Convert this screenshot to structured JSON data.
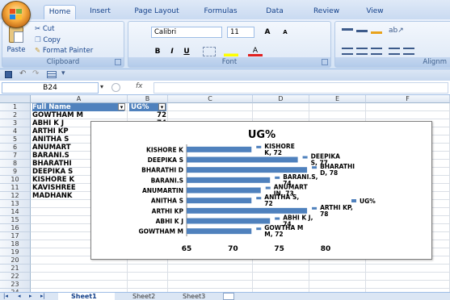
{
  "ribbon_tabs": [
    "Home",
    "Insert",
    "Page Layout",
    "Formulas",
    "Data",
    "Review",
    "View"
  ],
  "clipboard": {
    "paste_label": "Paste",
    "cut_label": "Cut",
    "copy_label": "Copy",
    "format_painter_label": "Format Painter",
    "group_label": "Clipboard"
  },
  "font": {
    "name": "Calibri",
    "size": "11",
    "group_label": "Font",
    "bold": "B",
    "italic": "I",
    "underline": "U",
    "grow": "A",
    "shrink": "A"
  },
  "alignment": {
    "group_label": "Alignm"
  },
  "name_box": "B24",
  "fx_label": "fx",
  "columns": [
    "A",
    "B",
    "C",
    "D",
    "E",
    "F"
  ],
  "rows": [
    {
      "num": "1",
      "a": "Full Name",
      "b": "UG%",
      "header": true
    },
    {
      "num": "2",
      "a": "GOWTHAM M",
      "b": "72"
    },
    {
      "num": "3",
      "a": "ABHI K J",
      "b": "74"
    },
    {
      "num": "4",
      "a": "ARTHI KP",
      "b": ""
    },
    {
      "num": "5",
      "a": "ANITHA S",
      "b": ""
    },
    {
      "num": "6",
      "a": "ANUMART",
      "b": ""
    },
    {
      "num": "7",
      "a": "BARANI.S",
      "b": ""
    },
    {
      "num": "8",
      "a": "BHARATHI",
      "b": ""
    },
    {
      "num": "9",
      "a": "DEEPIKA S",
      "b": ""
    },
    {
      "num": "10",
      "a": "KISHORE K",
      "b": ""
    },
    {
      "num": "11",
      "a": "KAVISHREE",
      "b": ""
    },
    {
      "num": "12",
      "a": "MADHANK",
      "b": ""
    },
    {
      "num": "13",
      "a": "",
      "b": ""
    },
    {
      "num": "14",
      "a": "",
      "b": ""
    },
    {
      "num": "15",
      "a": "",
      "b": ""
    },
    {
      "num": "16",
      "a": "",
      "b": ""
    },
    {
      "num": "17",
      "a": "",
      "b": ""
    },
    {
      "num": "18",
      "a": "",
      "b": ""
    },
    {
      "num": "19",
      "a": "",
      "b": ""
    },
    {
      "num": "20",
      "a": "",
      "b": ""
    },
    {
      "num": "21",
      "a": "",
      "b": ""
    },
    {
      "num": "22",
      "a": "",
      "b": ""
    },
    {
      "num": "23",
      "a": "",
      "b": ""
    },
    {
      "num": "24",
      "a": "",
      "b": ""
    }
  ],
  "sheets": [
    "Sheet1",
    "Sheet2",
    "Sheet3"
  ],
  "chart_data": {
    "type": "bar",
    "orientation": "horizontal",
    "title": "UG%",
    "categories": [
      "GOWTHAM M",
      "ABHI K J",
      "ARTHI KP",
      "ANITHA S",
      "ANUMARTIN",
      "BARANI.S",
      "BHARATHI D",
      "DEEPIKA S",
      "KISHORE K"
    ],
    "series": [
      {
        "name": "UG%",
        "values": [
          72,
          74,
          78,
          72,
          73,
          74,
          78,
          77,
          72
        ],
        "color": "#4f81bd"
      }
    ],
    "data_labels": [
      "GOWTHA M M, 72",
      "ABHI K J, 74",
      "ARTHI KP, 78",
      "ANITHA S, 72",
      "ANUMART IN, 73",
      "BARANI.S, 74",
      "BHARATHI D, 78",
      "DEEPIKA S, 77",
      "KISHORE K, 72"
    ],
    "xlim": [
      65,
      80
    ],
    "xticks": [
      65,
      70,
      75,
      80
    ],
    "legend": "right",
    "grid": false
  }
}
